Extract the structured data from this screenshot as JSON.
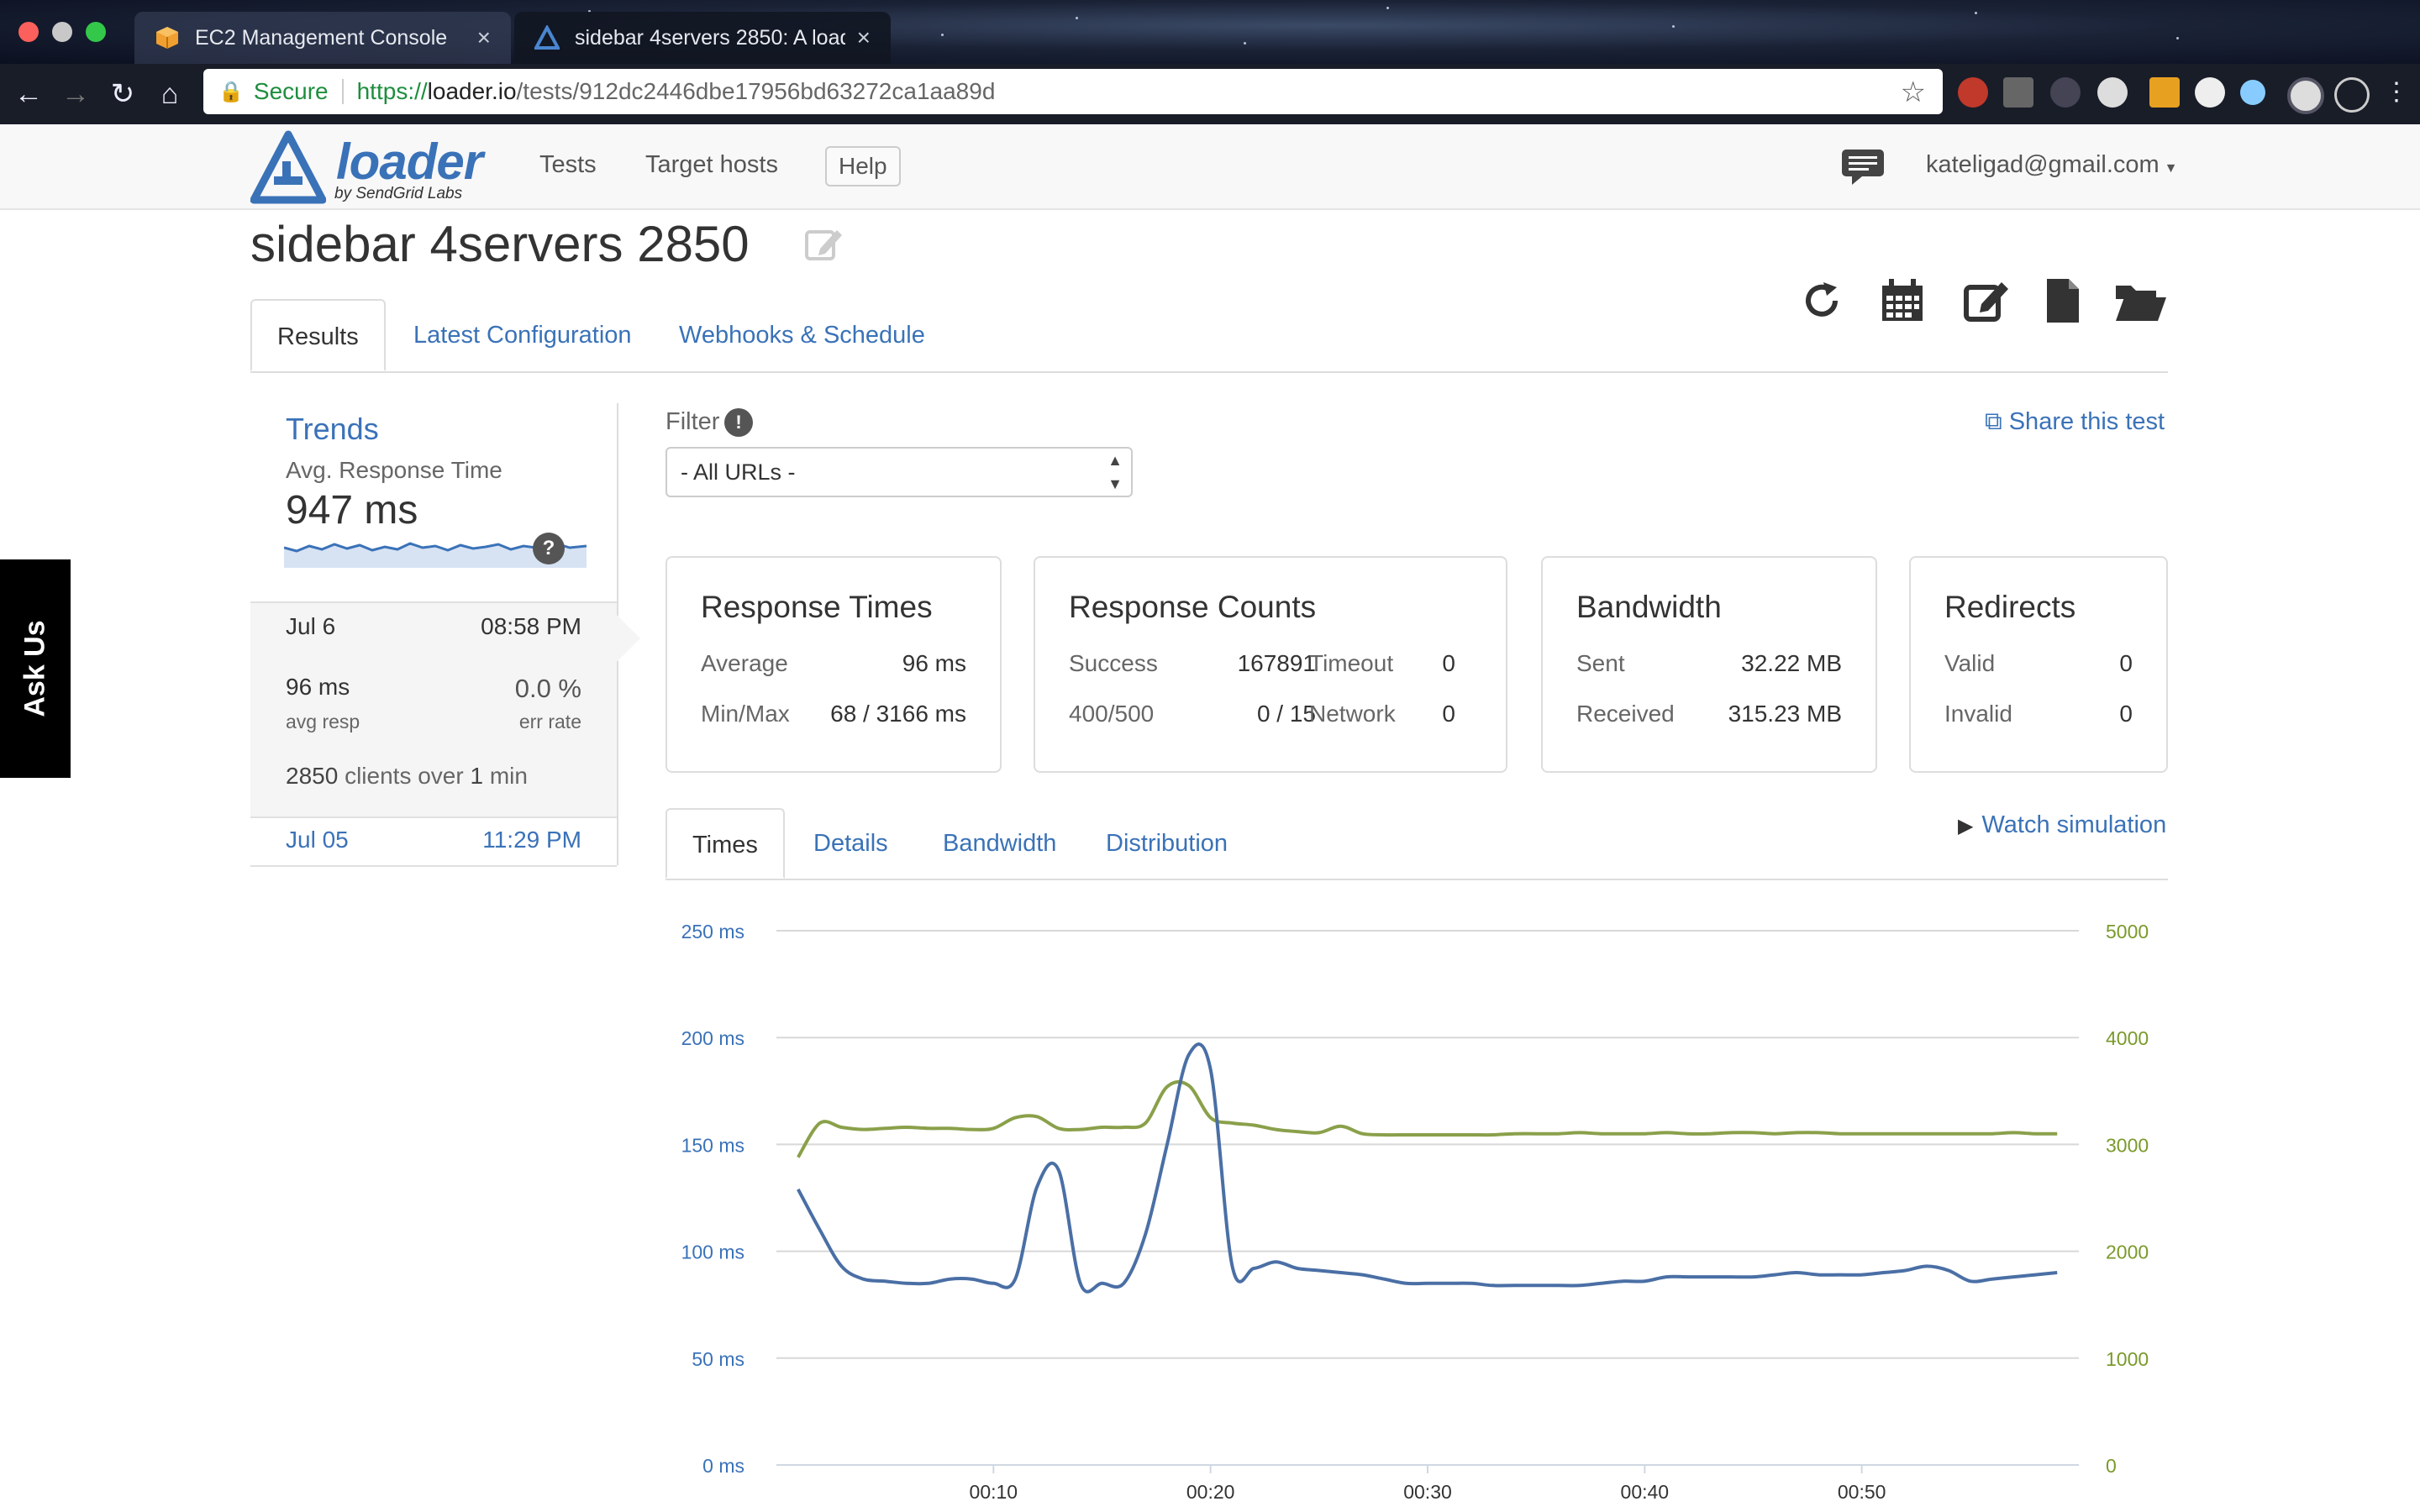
{
  "browser": {
    "tabs": [
      {
        "label": "EC2 Management Console",
        "close": "×"
      },
      {
        "label": "sidebar 4servers 2850: A load",
        "close": "×"
      }
    ],
    "address": {
      "secure_label": "Secure",
      "url_scheme": "https://",
      "url_host": "loader.io",
      "url_path": "/tests/912dc2446dbe17956bd63272ca1aa89d"
    }
  },
  "header": {
    "logo_word": "loader",
    "logo_byline": "by SendGrid Labs",
    "nav": [
      "Tests",
      "Target hosts",
      "Help"
    ],
    "user": "kateligad@gmail.com"
  },
  "page": {
    "title": "sidebar 4servers 2850",
    "tabs": [
      "Results",
      "Latest Configuration",
      "Webhooks & Schedule"
    ]
  },
  "sidebar": {
    "trends_title": "Trends",
    "trends_subtitle": "Avg. Response Time",
    "trends_value": "947 ms",
    "help": "?",
    "active_run": {
      "date": "Jul 6",
      "time": "08:58 PM",
      "avg_resp_value": "96 ms",
      "avg_resp_label": "avg resp",
      "err_rate_value": "0.0 %",
      "err_rate_label": "err rate",
      "clients_count": "2850",
      "clients_mid": "clients over",
      "duration_num": "1",
      "duration_unit": "min"
    },
    "other_run": {
      "date": "Jul 05",
      "time": "11:29 PM"
    }
  },
  "filter": {
    "label": "Filter",
    "info": "!",
    "selected": "- All URLs -",
    "share": "Share this test"
  },
  "panels": {
    "response_times": {
      "title": "Response Times",
      "rows": [
        {
          "label": "Average",
          "value": "96 ms"
        },
        {
          "label": "Min/Max",
          "value": "68 / 3166 ms"
        }
      ]
    },
    "response_counts": {
      "title": "Response Counts",
      "rows": [
        {
          "label": "Success",
          "value": "167891",
          "label2": "Timeout",
          "value2": "0"
        },
        {
          "label": "400/500",
          "value": "0 / 15",
          "label2": "Network",
          "value2": "0"
        }
      ]
    },
    "bandwidth": {
      "title": "Bandwidth",
      "rows": [
        {
          "label": "Sent",
          "value": "32.22 MB"
        },
        {
          "label": "Received",
          "value": "315.23 MB"
        }
      ]
    },
    "redirects": {
      "title": "Redirects",
      "rows": [
        {
          "label": "Valid",
          "value": "0"
        },
        {
          "label": "Invalid",
          "value": "0"
        }
      ]
    }
  },
  "chart_tabs": [
    "Times",
    "Details",
    "Bandwidth",
    "Distribution"
  ],
  "watch_simulation": "Watch simulation",
  "ask_us": "Ask Us",
  "colors": {
    "accent": "#3a72b8",
    "response_line": "#4a6fa5",
    "clients_line": "#8aa04a"
  },
  "chart_data": {
    "type": "line",
    "x_ticks": [
      "00:10",
      "00:20",
      "00:30",
      "00:40",
      "00:50"
    ],
    "xlim": [
      0,
      60
    ],
    "y_left": {
      "ticks": [
        "0 ms",
        "50 ms",
        "100 ms",
        "150 ms",
        "200 ms",
        "250 ms"
      ],
      "ylim": [
        0,
        250
      ]
    },
    "y_right": {
      "ticks": [
        "0",
        "1000",
        "2000",
        "3000",
        "4000",
        "5000"
      ],
      "ylim": [
        0,
        5000
      ]
    },
    "grid": true,
    "series": [
      {
        "axis": "left",
        "color": "#4a6fa5",
        "x": [
          1,
          2,
          3,
          4,
          5,
          6,
          7,
          8,
          9,
          10,
          11,
          12,
          13,
          14,
          15,
          16,
          17,
          18,
          19,
          20,
          21,
          22,
          23,
          24,
          25,
          26,
          27,
          28,
          29,
          30,
          31,
          32,
          33,
          34,
          35,
          36,
          37,
          38,
          39,
          40,
          41,
          42,
          43,
          44,
          45,
          46,
          47,
          48,
          49,
          50,
          51,
          52,
          53,
          54,
          55,
          56,
          57,
          58,
          59
        ],
        "values": [
          129,
          110,
          93,
          87,
          86,
          85,
          85,
          87,
          87,
          85,
          87,
          130,
          138,
          85,
          85,
          85,
          108,
          150,
          192,
          185,
          93,
          92,
          95,
          92,
          91,
          90,
          89,
          87,
          85,
          85,
          85,
          85,
          84,
          84,
          84,
          84,
          84,
          85,
          86,
          86,
          88,
          88,
          88,
          88,
          88,
          89,
          90,
          89,
          89,
          89,
          90,
          91,
          93,
          91,
          86,
          87,
          88,
          89,
          90
        ]
      },
      {
        "axis": "right",
        "color": "#8aa04a",
        "x": [
          1,
          2,
          3,
          4,
          5,
          6,
          7,
          8,
          9,
          10,
          11,
          12,
          13,
          14,
          15,
          16,
          17,
          18,
          19,
          20,
          21,
          22,
          23,
          24,
          25,
          26,
          27,
          28,
          29,
          30,
          31,
          32,
          33,
          34,
          35,
          36,
          37,
          38,
          39,
          40,
          41,
          42,
          43,
          44,
          45,
          46,
          47,
          48,
          49,
          50,
          51,
          52,
          53,
          54,
          55,
          56,
          57,
          58,
          59
        ],
        "values": [
          2880,
          3200,
          3160,
          3140,
          3150,
          3160,
          3150,
          3150,
          3140,
          3150,
          3250,
          3260,
          3150,
          3140,
          3160,
          3160,
          3200,
          3540,
          3550,
          3250,
          3200,
          3180,
          3140,
          3120,
          3110,
          3170,
          3100,
          3090,
          3090,
          3090,
          3090,
          3090,
          3090,
          3100,
          3100,
          3100,
          3110,
          3100,
          3100,
          3100,
          3110,
          3100,
          3100,
          3110,
          3110,
          3100,
          3110,
          3110,
          3100,
          3100,
          3100,
          3100,
          3100,
          3100,
          3100,
          3100,
          3110,
          3100,
          3100
        ]
      }
    ]
  }
}
